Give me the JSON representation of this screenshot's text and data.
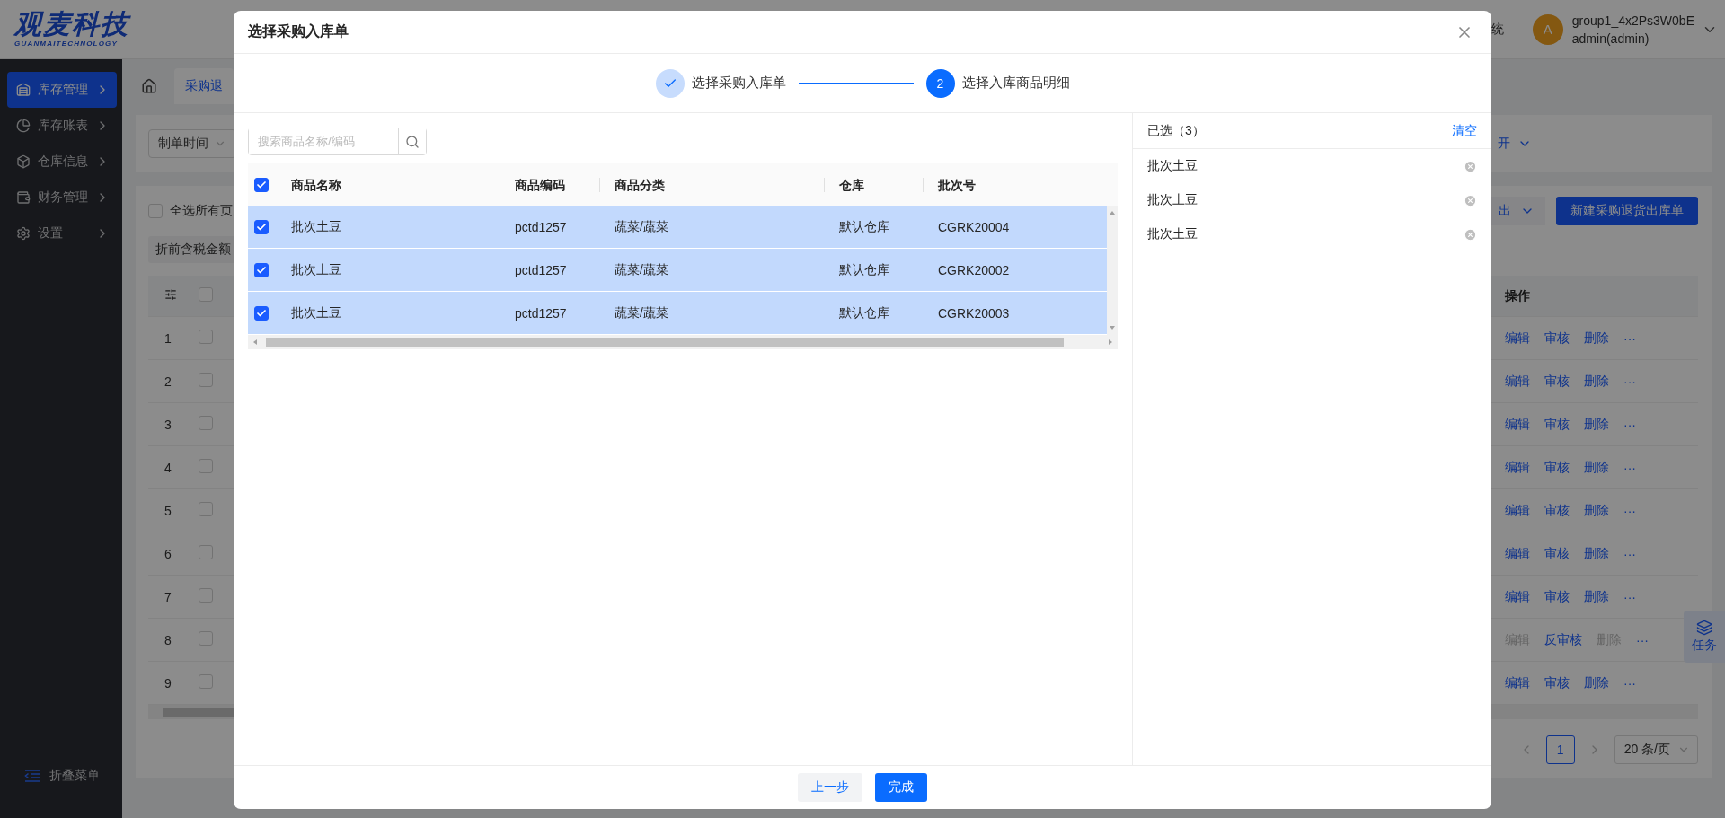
{
  "header": {
    "logo_text": "观麦科技",
    "logo_subtitle": "GUANMAITECHNOLOGY",
    "system_link": "统",
    "avatar_letter": "A",
    "user_name": "group1_4x2Ps3W0bE",
    "user_role": "admin(admin)"
  },
  "sidebar": {
    "items": [
      {
        "label": "库存管理",
        "selected": true
      },
      {
        "label": "库存账表",
        "selected": false
      },
      {
        "label": "仓库信息",
        "selected": false
      },
      {
        "label": "财务管理",
        "selected": false
      },
      {
        "label": "设置",
        "selected": false
      }
    ],
    "collapse_label": "折叠菜单"
  },
  "tabs": [
    {
      "label": "采购退",
      "selected": true
    }
  ],
  "filter": {
    "date_field": "制单时间",
    "expand_label": "开"
  },
  "toolbar": {
    "select_all_label": "全选所有页",
    "select_all_checked": false,
    "amount_chip": "折前含税金额",
    "export_label": "出",
    "new_button": "新建采购退货出库单"
  },
  "list": {
    "header_checked": false,
    "ops_header": "操作",
    "rows": [
      {
        "index": "1",
        "checked": false,
        "actions": [
          {
            "label": "编辑",
            "disabled": false
          },
          {
            "label": "审核",
            "disabled": false
          },
          {
            "label": "删除",
            "disabled": false
          },
          {
            "label": "···",
            "disabled": false
          }
        ]
      },
      {
        "index": "2",
        "checked": false,
        "actions": [
          {
            "label": "编辑",
            "disabled": false
          },
          {
            "label": "审核",
            "disabled": false
          },
          {
            "label": "删除",
            "disabled": false
          },
          {
            "label": "···",
            "disabled": false
          }
        ]
      },
      {
        "index": "3",
        "checked": false,
        "actions": [
          {
            "label": "编辑",
            "disabled": false
          },
          {
            "label": "审核",
            "disabled": false
          },
          {
            "label": "删除",
            "disabled": false
          },
          {
            "label": "···",
            "disabled": false
          }
        ]
      },
      {
        "index": "4",
        "checked": false,
        "actions": [
          {
            "label": "编辑",
            "disabled": false
          },
          {
            "label": "审核",
            "disabled": false
          },
          {
            "label": "删除",
            "disabled": false
          },
          {
            "label": "···",
            "disabled": false
          }
        ]
      },
      {
        "index": "5",
        "checked": false,
        "actions": [
          {
            "label": "编辑",
            "disabled": false
          },
          {
            "label": "审核",
            "disabled": false
          },
          {
            "label": "删除",
            "disabled": false
          },
          {
            "label": "···",
            "disabled": false
          }
        ]
      },
      {
        "index": "6",
        "checked": false,
        "actions": [
          {
            "label": "编辑",
            "disabled": false
          },
          {
            "label": "审核",
            "disabled": false
          },
          {
            "label": "删除",
            "disabled": false
          },
          {
            "label": "···",
            "disabled": false
          }
        ]
      },
      {
        "index": "7",
        "checked": false,
        "actions": [
          {
            "label": "编辑",
            "disabled": false
          },
          {
            "label": "审核",
            "disabled": false
          },
          {
            "label": "删除",
            "disabled": false
          },
          {
            "label": "···",
            "disabled": false
          }
        ]
      },
      {
        "index": "8",
        "checked": false,
        "actions": [
          {
            "label": "编辑",
            "disabled": true
          },
          {
            "label": "反审核",
            "disabled": false
          },
          {
            "label": "删除",
            "disabled": true
          },
          {
            "label": "···",
            "disabled": false
          }
        ]
      },
      {
        "index": "9",
        "checked": false,
        "actions": [
          {
            "label": "编辑",
            "disabled": false
          },
          {
            "label": "审核",
            "disabled": false
          },
          {
            "label": "删除",
            "disabled": false
          },
          {
            "label": "···",
            "disabled": false
          }
        ]
      }
    ]
  },
  "pagination": {
    "page": "1",
    "page_size": "20 条/页"
  },
  "task_button": "任务",
  "modal": {
    "title": "选择采购入库单",
    "steps": [
      {
        "label": "选择采购入库单",
        "completed": true
      },
      {
        "number": "2",
        "label": "选择入库商品明细",
        "completed": false
      }
    ],
    "search": {
      "placeholder": "搜索商品名称/编码"
    },
    "table": {
      "all_checked": true,
      "columns": [
        "商品名称",
        "商品编码",
        "商品分类",
        "仓库",
        "批次号"
      ],
      "rows": [
        {
          "checked": true,
          "cells": [
            "批次土豆",
            "pctd1257",
            "蔬菜/蔬菜",
            "默认仓库",
            "CGRK20004"
          ]
        },
        {
          "checked": true,
          "cells": [
            "批次土豆",
            "pctd1257",
            "蔬菜/蔬菜",
            "默认仓库",
            "CGRK20002"
          ]
        },
        {
          "checked": true,
          "cells": [
            "批次土豆",
            "pctd1257",
            "蔬菜/蔬菜",
            "默认仓库",
            "CGRK20003"
          ]
        }
      ]
    },
    "selected_panel": {
      "title": "已选（3）",
      "clear_label": "清空",
      "items": [
        "批次土豆",
        "批次土豆",
        "批次土豆"
      ]
    },
    "buttons": [
      {
        "label": "上一步",
        "kind": "secondary"
      },
      {
        "label": "完成",
        "kind": "primary"
      }
    ]
  }
}
